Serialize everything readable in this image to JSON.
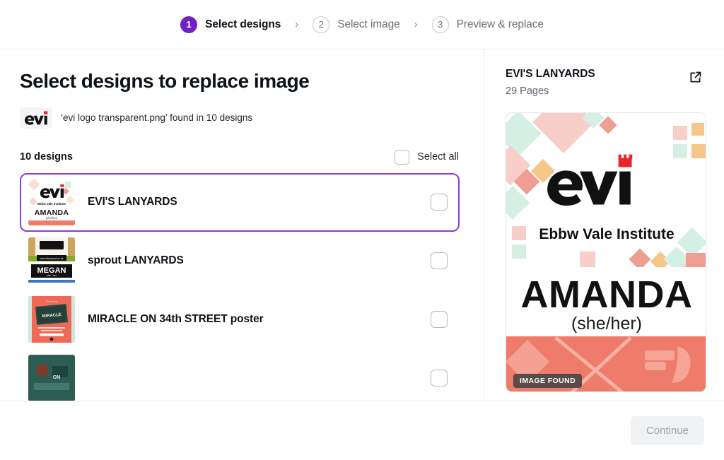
{
  "stepper": {
    "steps": [
      {
        "number": "1",
        "label": "Select designs",
        "state": "active"
      },
      {
        "number": "2",
        "label": "Select image",
        "state": "idle"
      },
      {
        "number": "3",
        "label": "Preview & replace",
        "state": "idle"
      }
    ],
    "separator": "›"
  },
  "main": {
    "title": "Select designs to replace image",
    "file_caption": "‘evi logo transparent.png’ found in 10 designs",
    "file_thumb_icon": "evi-logo-icon",
    "designs_count": "10 designs",
    "select_all_label": "Select all",
    "rows": [
      {
        "name": "EVI'S LANYARDS",
        "thumb": "evi-lanyard-thumb",
        "selected": true,
        "checked": false
      },
      {
        "name": "sprout LANYARDS",
        "thumb": "sprout-lanyard-thumb",
        "selected": false,
        "checked": false
      },
      {
        "name": "MIRACLE ON 34th STREET poster",
        "thumb": "miracle-poster-thumb",
        "selected": false,
        "checked": false
      },
      {
        "name": "",
        "thumb": "clipped-thumb",
        "selected": false,
        "checked": false
      }
    ]
  },
  "preview": {
    "title": "EVI'S LANYARDS",
    "pages": "29 Pages",
    "open_icon": "external-link-icon",
    "badge": "IMAGE FOUND",
    "design": {
      "logo_word": "evi",
      "logo_subtitle": "Ebbw Vale Institute",
      "name": "AMANDA",
      "pronouns": "(she/her)"
    }
  },
  "footer": {
    "continue_label": "Continue",
    "continue_disabled": true
  },
  "colors": {
    "accent_purple": "#7021c4",
    "selection_purple": "#8b3dde",
    "coral": "#ef7b6a",
    "crown_red": "#e8262a",
    "divider": "#ebecf0",
    "badge_bg": "#5a4b48"
  }
}
